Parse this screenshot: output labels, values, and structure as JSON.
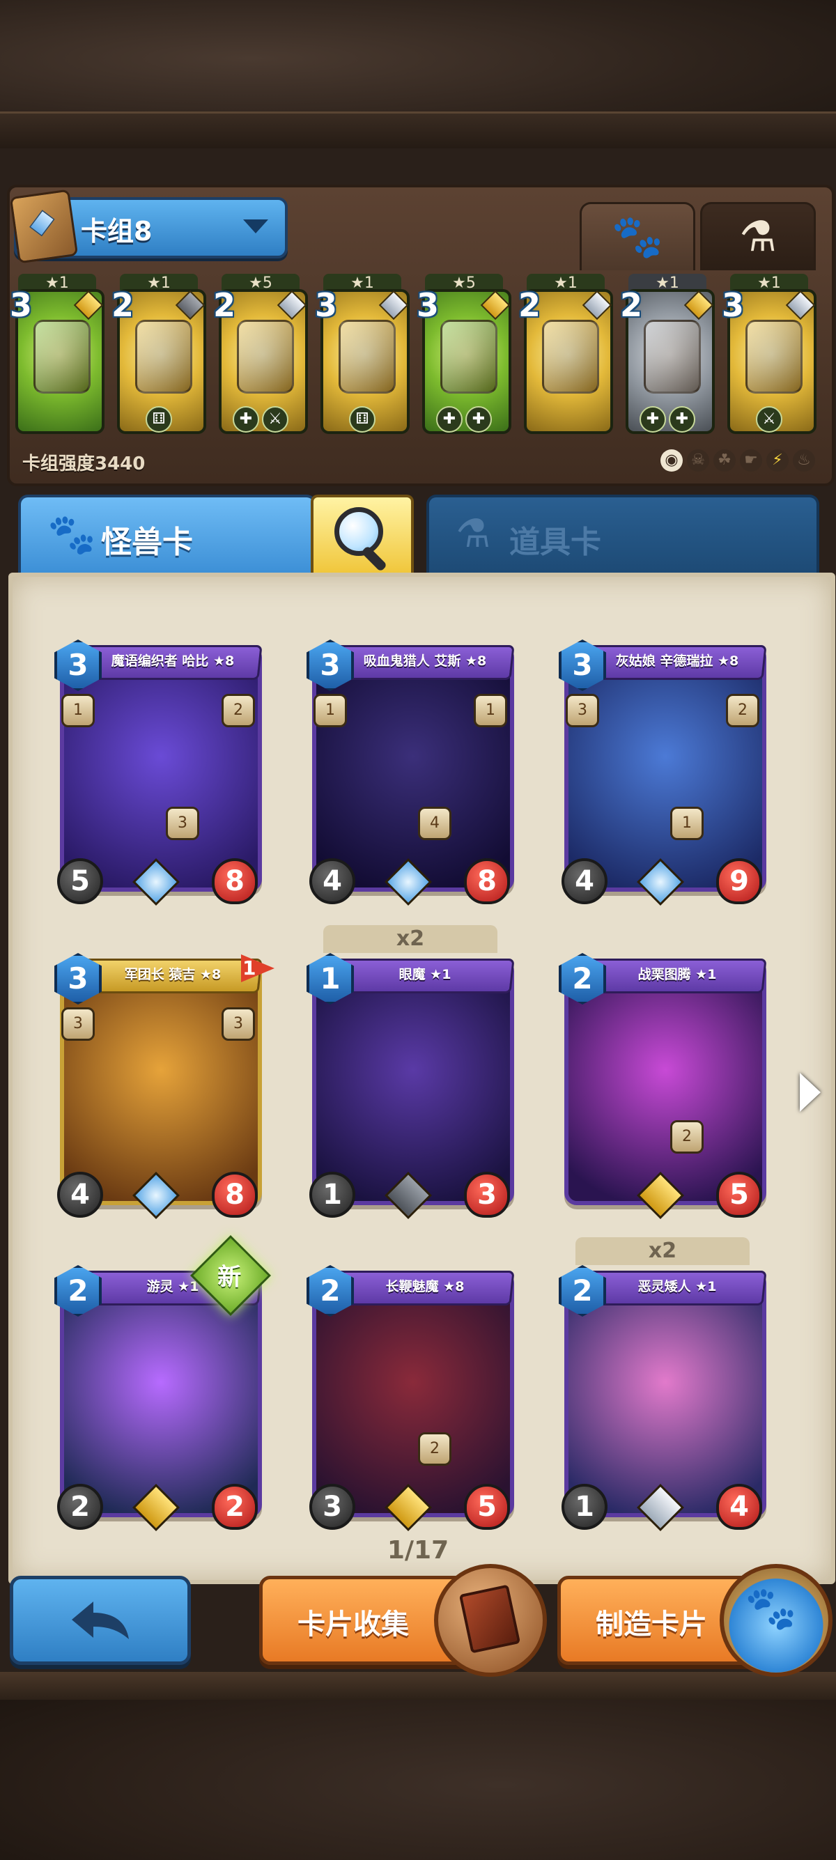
{
  "deck": {
    "selector_label": "卡组8",
    "power_label": "卡组强度3440",
    "tabs": [
      {
        "icon": "paw-icon",
        "active": false
      },
      {
        "icon": "potion-icon",
        "active": true
      }
    ],
    "cards": [
      {
        "stars": "★1",
        "cost": "3",
        "rarity": "gold",
        "theme": "green",
        "foot": []
      },
      {
        "stars": "★1",
        "cost": "2",
        "rarity": "dark",
        "theme": "gold",
        "foot": [
          "⚅"
        ]
      },
      {
        "stars": "★5",
        "cost": "2",
        "rarity": "silver",
        "theme": "gold",
        "foot": [
          "✚",
          "⚔"
        ]
      },
      {
        "stars": "★1",
        "cost": "3",
        "rarity": "silver",
        "theme": "gold",
        "foot": [
          "⚅"
        ]
      },
      {
        "stars": "★5",
        "cost": "3",
        "rarity": "gold",
        "theme": "green",
        "foot": [
          "✚",
          "✚"
        ]
      },
      {
        "stars": "★1",
        "cost": "2",
        "rarity": "silver",
        "theme": "gold",
        "foot": []
      },
      {
        "stars": "★1",
        "cost": "2",
        "rarity": "gold",
        "theme": "gray",
        "foot": [
          "✚",
          "✚"
        ]
      },
      {
        "stars": "★1",
        "cost": "3",
        "rarity": "silver",
        "theme": "gold",
        "foot": [
          "⚔"
        ]
      }
    ],
    "filters": [
      "◉",
      "☠",
      "☘",
      "☛",
      "⚡",
      "♨"
    ]
  },
  "categories": {
    "monster_label": "怪兽卡",
    "item_label": "道具卡"
  },
  "cards": [
    {
      "name": "魔语编织者 哈比 ★8",
      "cost": "3",
      "atk": "5",
      "hp": "8",
      "rarity": "star",
      "frame": "purple",
      "art": [
        "#6a4bd6",
        "#2a1a66"
      ],
      "skills": [
        "1",
        "2"
      ],
      "mids": [
        "3"
      ]
    },
    {
      "name": "吸血鬼猎人 艾斯 ★8",
      "cost": "3",
      "atk": "4",
      "hp": "8",
      "rarity": "star",
      "frame": "purple",
      "art": [
        "#3b2f7a",
        "#120c33"
      ],
      "skills": [
        "1",
        "1"
      ],
      "mids": [
        "4"
      ]
    },
    {
      "name": "灰姑娘 辛德瑞拉 ★8",
      "cost": "3",
      "atk": "4",
      "hp": "9",
      "rarity": "star",
      "frame": "purple",
      "art": [
        "#4c7ad6",
        "#1c2a66"
      ],
      "skills": [
        "3",
        "2"
      ],
      "mids": [
        "1"
      ]
    },
    {
      "name": "军团长 猿吉 ★8",
      "cost": "3",
      "atk": "4",
      "hp": "8",
      "rarity": "star",
      "frame": "gold",
      "art": [
        "#e6a33a",
        "#6a3a12"
      ],
      "skills": [
        "3",
        "3"
      ],
      "mids": [],
      "flag": "1"
    },
    {
      "name": "眼魔 ★1",
      "cost": "1",
      "atk": "1",
      "hp": "3",
      "rarity": "dark",
      "frame": "purple",
      "art": [
        "#5a3aa6",
        "#1a1240"
      ],
      "skills": [],
      "mids": [],
      "count": "x2"
    },
    {
      "name": "战栗图腾 ★1",
      "cost": "2",
      "atk": "",
      "hp": "5",
      "rarity": "gold",
      "frame": "purple",
      "art": [
        "#c84ad6",
        "#2a1450"
      ],
      "skills": [],
      "mids": [
        "2"
      ]
    },
    {
      "name": "游灵 ★1",
      "cost": "2",
      "atk": "2",
      "hp": "2",
      "rarity": "gold",
      "frame": "purple",
      "art": [
        "#b76bff",
        "#1f2a55"
      ],
      "skills": [],
      "mids": [],
      "new_label": "新"
    },
    {
      "name": "长鞭魅魔 ★8",
      "cost": "2",
      "atk": "3",
      "hp": "5",
      "rarity": "gold",
      "frame": "purple",
      "art": [
        "#8a2a3a",
        "#2a1230"
      ],
      "skills": [],
      "mids": [
        "2"
      ]
    },
    {
      "name": "恶灵矮人 ★1",
      "cost": "2",
      "atk": "1",
      "hp": "4",
      "rarity": "silver",
      "frame": "purple",
      "art": [
        "#e27acb",
        "#2a2a66"
      ],
      "skills": [],
      "mids": [],
      "count": "x2"
    }
  ],
  "pager": {
    "text": "1/17"
  },
  "buttons": {
    "collect_label": "卡片收集",
    "craft_label": "制造卡片"
  }
}
